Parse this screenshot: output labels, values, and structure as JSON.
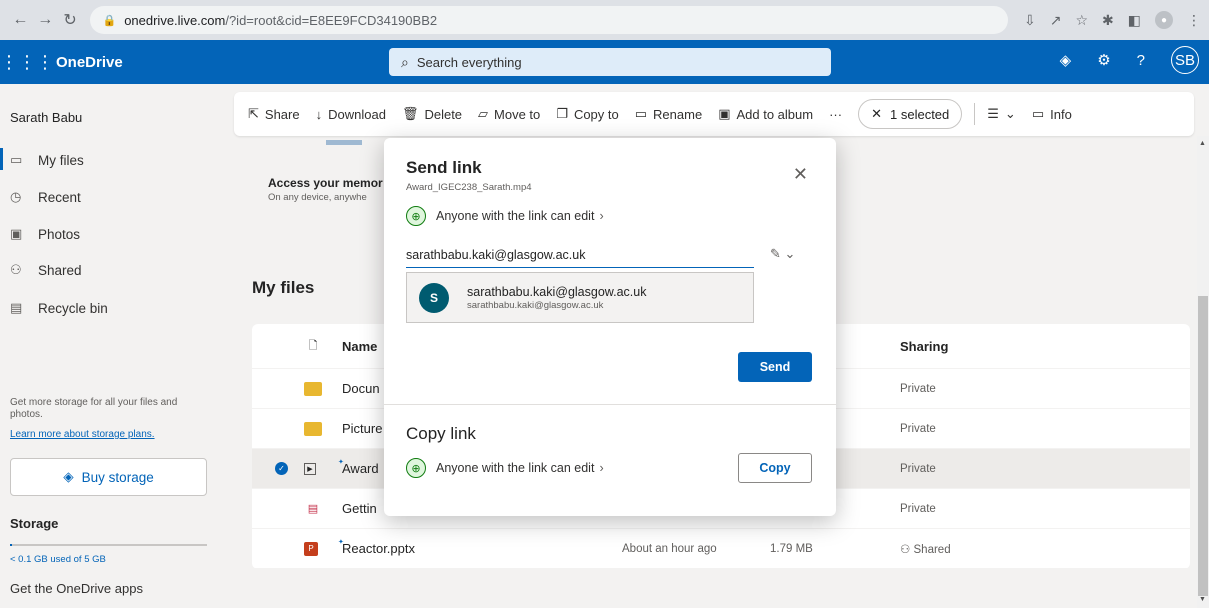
{
  "browser": {
    "url_host": "onedrive.live.com",
    "url_path": "/?id=root&cid=E8EE9FCD34190BB2"
  },
  "header": {
    "brand": "OneDrive",
    "search_placeholder": "Search everything",
    "avatar_initials": "SB"
  },
  "sidebar": {
    "user_name": "Sarath Babu",
    "items": [
      {
        "label": "My files",
        "icon": "folder-icon"
      },
      {
        "label": "Recent",
        "icon": "clock-icon"
      },
      {
        "label": "Photos",
        "icon": "photo-icon"
      },
      {
        "label": "Shared",
        "icon": "people-icon"
      },
      {
        "label": "Recycle bin",
        "icon": "recycle-bin-icon"
      }
    ],
    "storage_promo": "Get more storage for all your files and photos.",
    "storage_link": "Learn more about storage plans.",
    "buy_storage": "Buy storage",
    "storage_heading": "Storage",
    "storage_used": "< 0.1 GB used of 5 GB",
    "storage_fraction": 0.01,
    "get_apps": "Get the OneDrive apps"
  },
  "toolbar": {
    "share": "Share",
    "download": "Download",
    "delete": "Delete",
    "move_to": "Move to",
    "copy_to": "Copy to",
    "rename": "Rename",
    "add_to_album": "Add to album",
    "more": "···",
    "selected": "1 selected",
    "info": "Info"
  },
  "banner": {
    "title": "Access your memor",
    "subtitle": "On any device, anywhe"
  },
  "main": {
    "title": "My files",
    "columns": {
      "name": "Name",
      "sharing": "Sharing"
    },
    "rows": [
      {
        "name": "Docun",
        "modified": "",
        "size": "",
        "sharing": "Private"
      },
      {
        "name": "Picture",
        "modified": "",
        "size": "",
        "sharing": "Private"
      },
      {
        "name": "Award",
        "modified": "",
        "size": "",
        "sharing": "Private"
      },
      {
        "name": "Gettin",
        "modified": "",
        "size": "",
        "sharing": "Private"
      },
      {
        "name": "Reactor.pptx",
        "modified": "About an hour ago",
        "size": "1.79 MB",
        "sharing": "Shared"
      }
    ]
  },
  "dialog": {
    "title": "Send link",
    "file_name": "Award_IGEC238_Sarath.mp4",
    "permission": "Anyone with the link can edit",
    "email_value": "sarathbabu.kaki@glasgow.ac.uk",
    "suggestion": {
      "initial": "S",
      "name": "sarathbabu.kaki@glasgow.ac.uk",
      "email": "sarathbabu.kaki@glasgow.ac.uk"
    },
    "send": "Send",
    "copy_title": "Copy link",
    "copy_permission": "Anyone with the link can edit",
    "copy": "Copy"
  }
}
